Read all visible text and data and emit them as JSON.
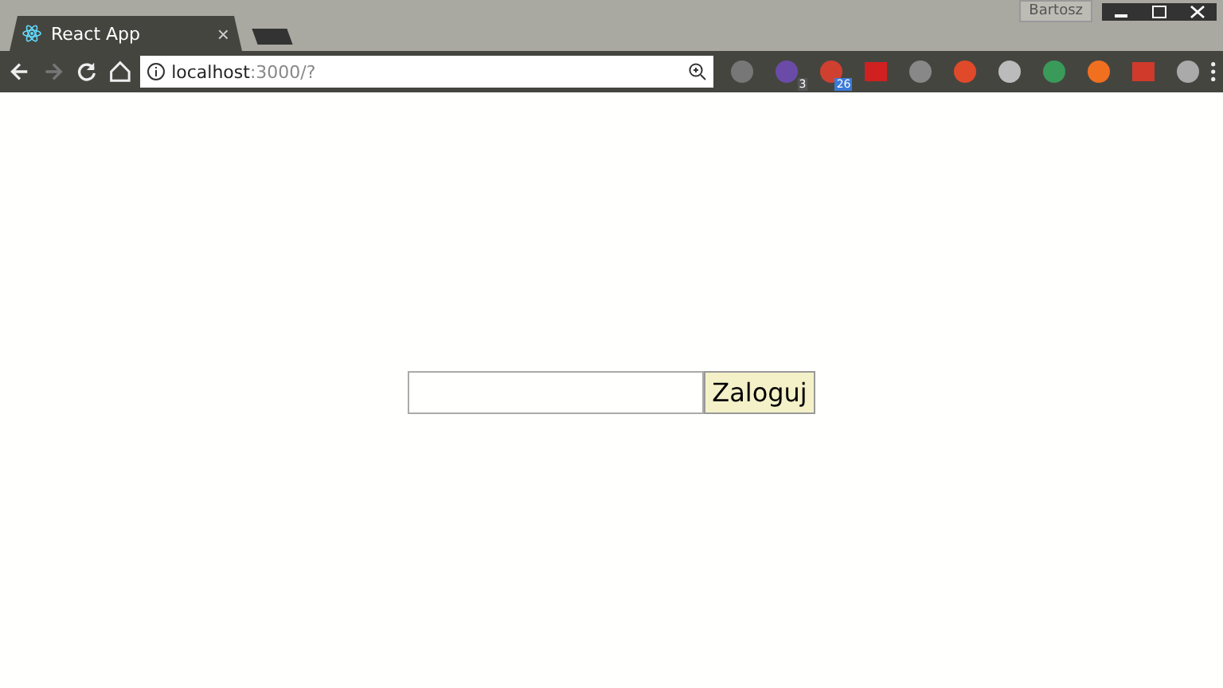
{
  "window": {
    "profile": "Bartosz"
  },
  "tabs": [
    {
      "title": "React App",
      "close": "×",
      "selected": true
    },
    {
      "selected": false
    }
  ],
  "address_bar": {
    "host": "localhost",
    "path": ":3000/?"
  },
  "extension_badges": [
    "3",
    "26"
  ],
  "login": {
    "button": "Zaloguj"
  }
}
